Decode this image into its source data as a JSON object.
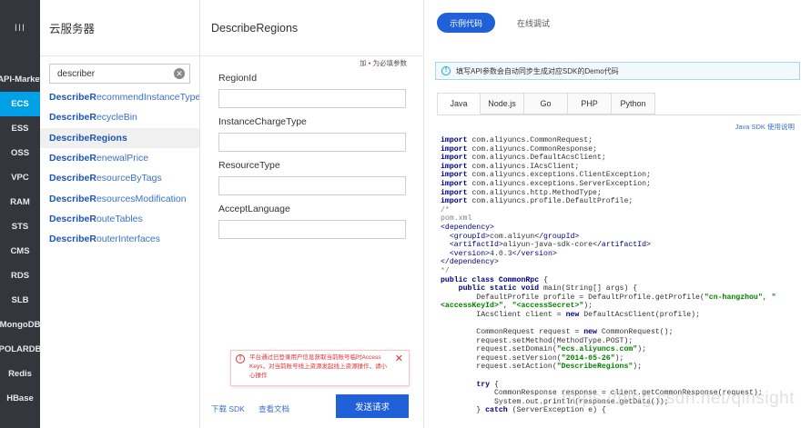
{
  "nav": {
    "menu_icon": "III",
    "items": [
      "API-Market",
      "ECS",
      "ESS",
      "OSS",
      "VPC",
      "RAM",
      "STS",
      "CMS",
      "RDS",
      "SLB",
      "MongoDB",
      "POLARDB",
      "Redis",
      "HBase"
    ],
    "active_index": 1,
    "active_color": "#00a0e9"
  },
  "apilist": {
    "title": "云服务器",
    "search_value": "describer",
    "search_clear_icon": "clear-circle-icon",
    "items": [
      {
        "match": "DescribeR",
        "rest": "ecommendInstanceType"
      },
      {
        "match": "DescribeR",
        "rest": "ecycleBin"
      },
      {
        "match": "DescribeRegions",
        "rest": ""
      },
      {
        "match": "DescribeR",
        "rest": "enewalPrice"
      },
      {
        "match": "DescribeR",
        "rest": "esourceByTags"
      },
      {
        "match": "DescribeR",
        "rest": "esourcesModification"
      },
      {
        "match": "DescribeR",
        "rest": "outeTables"
      },
      {
        "match": "DescribeR",
        "rest": "outerInterfaces"
      }
    ],
    "selected_index": 2
  },
  "params": {
    "title": "DescribeRegions",
    "required_note_prefix": "加",
    "required_note_dot": "•",
    "required_note_text": "为必填参数",
    "fields": [
      {
        "label": "RegionId",
        "value": ""
      },
      {
        "label": "InstanceChargeType",
        "value": ""
      },
      {
        "label": "ResourceType",
        "value": ""
      },
      {
        "label": "AcceptLanguage",
        "value": ""
      }
    ],
    "warning_text": "平台通过已登录用户信息获取当前账号临时Access Keys，对当前账号线上资源发起线上资源操作，请小心操作",
    "download_sdk": "下载 SDK",
    "view_docs": "查看文档",
    "send_button": "发送请求"
  },
  "code": {
    "tab_active": "示例代码",
    "tab_other": "在线调试",
    "info_text": "填写API参数会自动同步生成对应SDK的Demo代码",
    "lang_tabs": [
      "Java",
      "Node.js",
      "Go",
      "PHP",
      "Python"
    ],
    "sdk_doc_link": "Java SDK 使用说明",
    "watermark": "https://blog.csdn.net/qinsight",
    "accent": "#2060d8"
  }
}
